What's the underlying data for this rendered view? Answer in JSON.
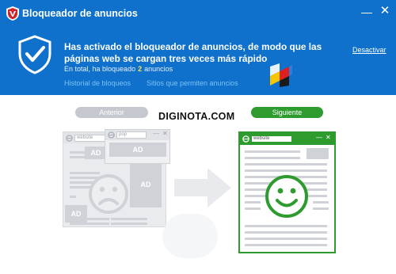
{
  "window": {
    "title": "Bloqueador de anuncios",
    "minimize_glyph": "—",
    "close_glyph": "✕"
  },
  "banner": {
    "headline_line1": "Has activado el bloqueador de anuncios, de modo que las",
    "headline_line2": "páginas web se cargan tres veces más rápido",
    "blocked_prefix": "En total, ha bloqueado",
    "blocked_count": "2",
    "blocked_suffix": "anuncios",
    "history_link": "Historial de bloqueos",
    "allowed_sites_link": "Sitios que permiten anuncios",
    "deactivate_link": "Desactivar"
  },
  "illustration": {
    "watermark": "DIGINOTA.COM",
    "before_label": "Anterior",
    "after_label": "Siguiente",
    "address_text": "website",
    "ad_label": "AD",
    "popup_address": "pop"
  },
  "colors": {
    "header_blue": "#0f71cc",
    "accent_green": "#2e9b2e",
    "count_yellow": "#ffe24a",
    "muted_gray": "#cfd3d8"
  },
  "icons": {
    "app_logo": "shield-logo-icon",
    "banner_shield": "checkmark-shield-icon",
    "brand": "color-emblem-icon",
    "browser": "ie-icon",
    "sad": "sad-face-icon",
    "happy": "happy-face-icon",
    "arrow": "right-arrow-icon"
  }
}
